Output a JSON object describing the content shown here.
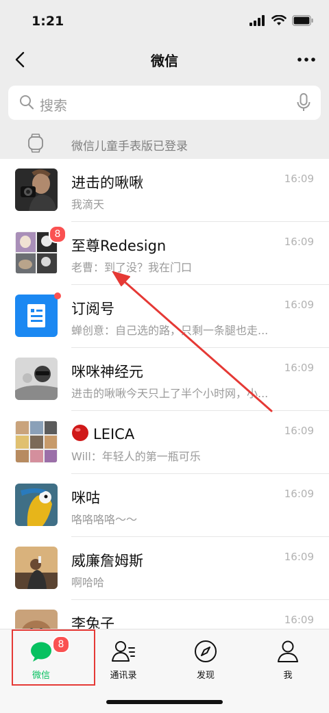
{
  "status": {
    "time": "1:21"
  },
  "nav": {
    "title": "微信"
  },
  "search": {
    "placeholder": "搜索"
  },
  "watch": {
    "text": "微信儿童手表版已登录"
  },
  "chats": [
    {
      "name": "进击的啾啾",
      "message": "我滴天",
      "time": "16:09"
    },
    {
      "name": "至尊Redesign",
      "message": "老曹：到了没？我在门口",
      "time": "16:09",
      "badge": "8"
    },
    {
      "name": "订阅号",
      "message": "蝉创意：自己选的路，只剩一条腿也走...",
      "time": "16:09"
    },
    {
      "name": "咪咪神经元",
      "message": "进击的啾啾今天只上了半个小时网，小...",
      "time": "16:09"
    },
    {
      "name": "LEICA",
      "message": "Will：年轻人的第一瓶可乐",
      "time": "16:09"
    },
    {
      "name": "咪咕",
      "message": "咯咯咯咯～～",
      "time": "16:09"
    },
    {
      "name": "威廉詹姆斯",
      "message": "啊哈哈",
      "time": "16:09"
    },
    {
      "name": "李兔子",
      "message": "",
      "time": "16:09"
    }
  ],
  "tabs": [
    {
      "label": "微信",
      "badge": "8"
    },
    {
      "label": "通讯录"
    },
    {
      "label": "发现"
    },
    {
      "label": "我"
    }
  ],
  "colors": {
    "accent": "#07c160",
    "badge": "#fa5151",
    "annotation": "#e53935",
    "subscription_blue": "#1b88f2"
  },
  "icons": {
    "back": "chevron-left-icon",
    "more": "ellipsis-icon",
    "search": "search-icon",
    "mic": "microphone-icon",
    "watch": "watch-icon"
  }
}
